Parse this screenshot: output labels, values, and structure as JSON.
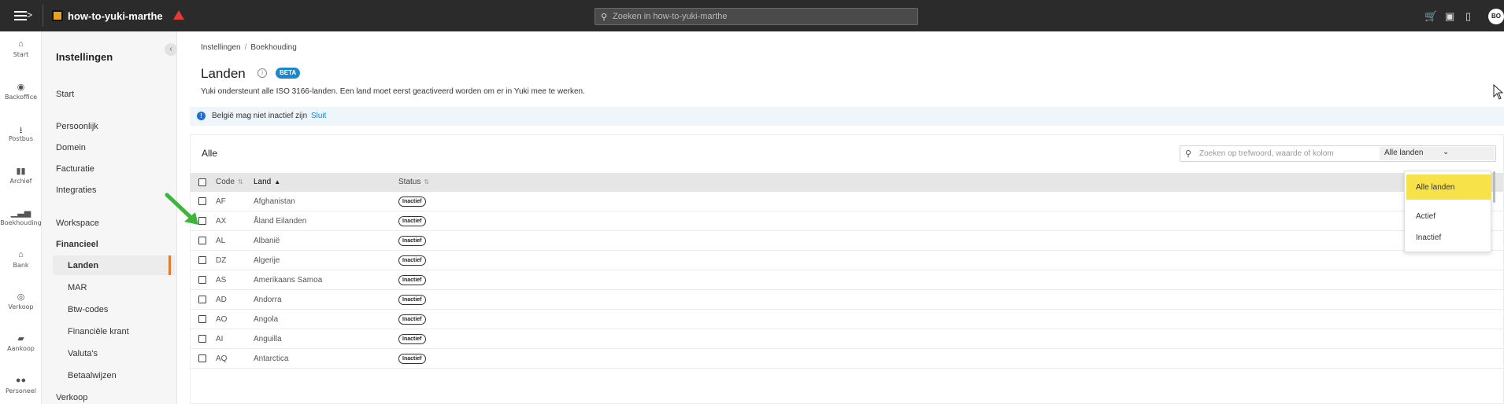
{
  "topbar": {
    "menu_glyph": ">",
    "app_title": "how-to-yuki-marthe",
    "search_placeholder": "Zoeken in how-to-yuki-marthe",
    "avatar_initials": "BO",
    "icons": [
      "menu-icon",
      "org-logo-icon",
      "warning-icon",
      "search-icon",
      "cart-icon",
      "gift-icon",
      "bookmark-icon"
    ]
  },
  "rail": {
    "items": [
      {
        "label": "Start",
        "icon": "home-icon",
        "glyph": "⌂"
      },
      {
        "label": "Backoffice",
        "icon": "backoffice-icon",
        "glyph": "◉"
      },
      {
        "label": "Postbus",
        "icon": "inbox-icon",
        "glyph": "⭳"
      },
      {
        "label": "Archief",
        "icon": "archive-icon",
        "glyph": "▮▮"
      },
      {
        "label": "Boekhouding",
        "icon": "bar-chart-icon",
        "glyph": "▁▃▅"
      },
      {
        "label": "Bank",
        "icon": "bank-icon",
        "glyph": "⌂"
      },
      {
        "label": "Verkoop",
        "icon": "sales-icon",
        "glyph": "◎"
      },
      {
        "label": "Aankoop",
        "icon": "truck-icon",
        "glyph": "▰"
      },
      {
        "label": "Personeel",
        "icon": "people-icon",
        "glyph": "●●"
      }
    ]
  },
  "sidebar": {
    "title": "Instellingen",
    "collapse_glyph": "‹",
    "items": [
      {
        "label": "Start"
      },
      {
        "label": "Persoonlijk"
      },
      {
        "label": "Domein"
      },
      {
        "label": "Facturatie"
      },
      {
        "label": "Integraties"
      },
      {
        "label": "Workspace"
      },
      {
        "label": "Financieel"
      },
      {
        "label": "Landen"
      },
      {
        "label": "MAR"
      },
      {
        "label": "Btw-codes"
      },
      {
        "label": "Financiële krant"
      },
      {
        "label": "Valuta's"
      },
      {
        "label": "Betaalwijzen"
      },
      {
        "label": "Verkoop"
      }
    ],
    "active_color": "#e07a2f"
  },
  "breadcrumb": {
    "items": [
      "Instellingen",
      "Boekhouding"
    ],
    "separator": "/"
  },
  "page": {
    "title": "Landen",
    "info_glyph": "i",
    "badge": "BETA",
    "description": "Yuki ondersteunt alle ISO 3166-landen. Een land moet eerst geactiveerd worden om er in Yuki mee te werken."
  },
  "alert": {
    "icon_glyph": "!",
    "text": "België mag niet inactief zijn",
    "action": "Sluit"
  },
  "table": {
    "heading": "Alle",
    "search_placeholder": "Zoeken op trefwoord, waarde of kolom",
    "filter_selected": "Alle landen",
    "filter_chevron": "⌄",
    "columns": [
      "Code",
      "Land",
      "Status"
    ],
    "sort_glyphs": {
      "neutral": "⇅",
      "asc": "▲"
    },
    "sorted_by": "Land",
    "rows": [
      {
        "code": "AF",
        "land": "Afghanistan",
        "status": "Inactief"
      },
      {
        "code": "AX",
        "land": "Åland Eilanden",
        "status": "Inactief"
      },
      {
        "code": "AL",
        "land": "Albanië",
        "status": "Inactief"
      },
      {
        "code": "DZ",
        "land": "Algerije",
        "status": "Inactief"
      },
      {
        "code": "AS",
        "land": "Amerikaans Samoa",
        "status": "Inactief"
      },
      {
        "code": "AD",
        "land": "Andorra",
        "status": "Inactief"
      },
      {
        "code": "AO",
        "land": "Angola",
        "status": "Inactief"
      },
      {
        "code": "AI",
        "land": "Anguilla",
        "status": "Inactief"
      },
      {
        "code": "AQ",
        "land": "Antarctica",
        "status": "Inactief"
      }
    ]
  },
  "filter_menu": {
    "options": [
      "Alle landen",
      "Actief",
      "Inactief"
    ],
    "selected_index": 0,
    "highlight_color": "#f7e24a"
  },
  "annotation": {
    "arrow_color": "#3db53d"
  }
}
